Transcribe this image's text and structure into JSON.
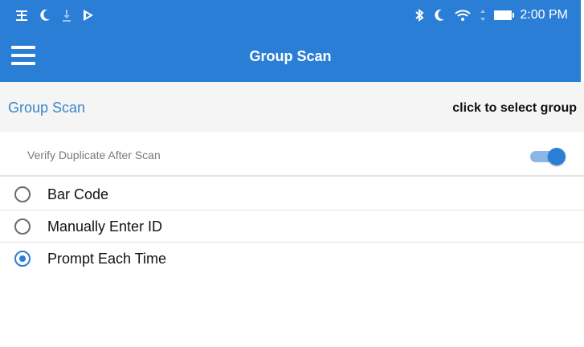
{
  "status_bar": {
    "left_icons": [
      "usb-debug-icon",
      "moon-icon",
      "download-icon",
      "play-store-icon"
    ],
    "right_icons": [
      "bluetooth-icon",
      "moon-icon",
      "wifi-icon",
      "battery-icon"
    ],
    "time": "2:00 PM"
  },
  "toolbar": {
    "title": "Group Scan"
  },
  "group": {
    "label": "Group Scan",
    "select_text": "click to select group"
  },
  "verify": {
    "label": "Verify Duplicate After Scan",
    "enabled": true
  },
  "scan_options": [
    {
      "label": "Bar Code",
      "selected": false
    },
    {
      "label": "Manually Enter ID",
      "selected": false
    },
    {
      "label": "Prompt Each Time",
      "selected": true
    }
  ],
  "colors": {
    "accent": "#2b7ed6",
    "group_label": "#3a86c8"
  }
}
